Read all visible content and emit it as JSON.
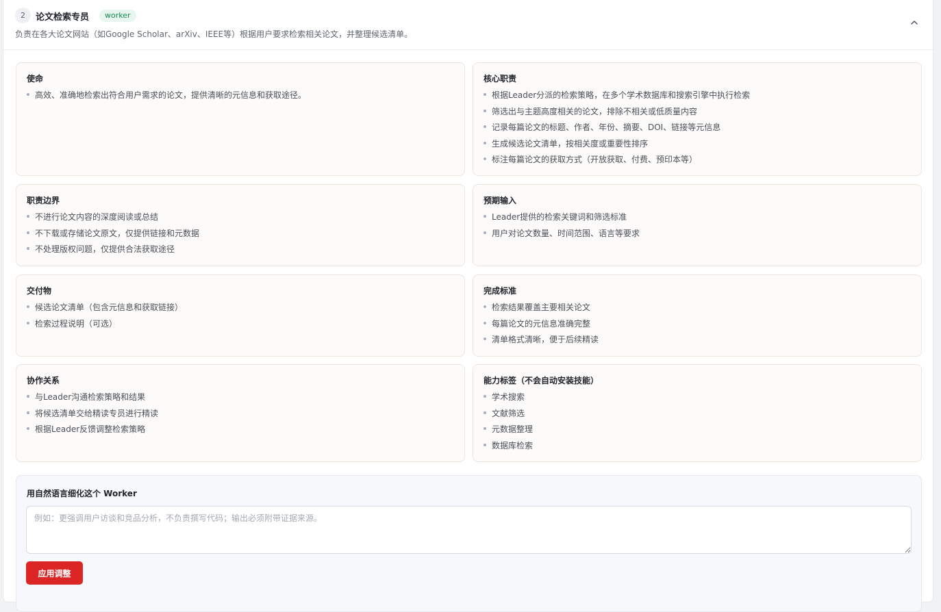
{
  "header": {
    "step": "2",
    "title": "论文检索专员",
    "tag": "worker",
    "description": "负责在各大论文网站（如Google Scholar、arXiv、IEEE等）根据用户要求检索相关论文，并整理候选清单。",
    "collapse_icon": "chevron-up-icon"
  },
  "cards": {
    "mission": {
      "title": "使命",
      "items": [
        "高效、准确地检索出符合用户需求的论文，提供清晰的元信息和获取途径。"
      ]
    },
    "duties": {
      "title": "核心职责",
      "items": [
        "根据Leader分派的检索策略，在多个学术数据库和搜索引擎中执行检索",
        "筛选出与主题高度相关的论文，排除不相关或低质量内容",
        "记录每篇论文的标题、作者、年份、摘要、DOI、链接等元信息",
        "生成候选论文清单，按相关度或重要性排序",
        "标注每篇论文的获取方式（开放获取、付费、预印本等）"
      ]
    },
    "boundary": {
      "title": "职责边界",
      "items": [
        "不进行论文内容的深度阅读或总结",
        "不下载或存储论文原文，仅提供链接和元数据",
        "不处理版权问题，仅提供合法获取途径"
      ]
    },
    "inputs": {
      "title": "预期输入",
      "items": [
        "Leader提供的检索关键词和筛选标准",
        "用户对论文数量、时间范围、语言等要求"
      ]
    },
    "deliverables": {
      "title": "交付物",
      "items": [
        "候选论文清单（包含元信息和获取链接）",
        "检索过程说明（可选）"
      ]
    },
    "criteria": {
      "title": "完成标准",
      "items": [
        "检索结果覆盖主要相关论文",
        "每篇论文的元信息准确完整",
        "清单格式清晰，便于后续精读"
      ]
    },
    "collaboration": {
      "title": "协作关系",
      "items": [
        "与Leader沟通检索策略和结果",
        "将候选清单交给精读专员进行精读",
        "根据Leader反馈调整检索策略"
      ]
    },
    "skills": {
      "title": "能力标签（不会自动安装技能）",
      "items": [
        "学术搜索",
        "文献筛选",
        "元数据整理",
        "数据库检索"
      ]
    }
  },
  "refine": {
    "title": "用自然语言细化这个 Worker",
    "placeholder": "例如：更强调用户访谈和竞品分析，不负责撰写代码；输出必须附带证据来源。",
    "value": "",
    "button": "应用调整"
  },
  "colors": {
    "accent": "#dc2626",
    "tag_bg": "#e7f6ee",
    "tag_text": "#1b8a4e",
    "card_bg": "#fcfbf9",
    "card_border": "#efe4dc"
  }
}
